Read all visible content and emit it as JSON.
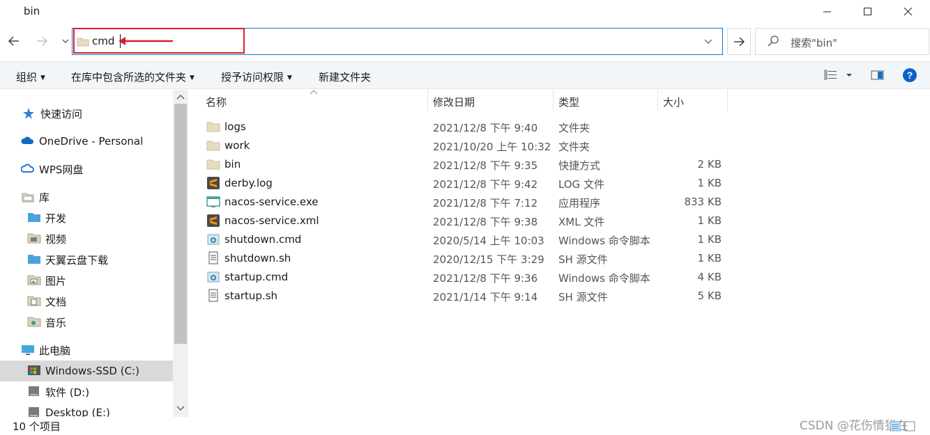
{
  "window": {
    "title": "bin",
    "minimize_icon": "minimize-icon",
    "maximize_icon": "maximize-icon",
    "close_icon": "close-icon"
  },
  "address_bar": {
    "nav_back": "←",
    "nav_forward": "→",
    "nav_recent": "⌄",
    "value": "cmd",
    "dropdown": "⌄",
    "go": "→",
    "highlight_color": "#d9202a"
  },
  "search": {
    "placeholder": "搜索\"bin\""
  },
  "toolbar": {
    "organize": "组织",
    "include_in_library": "在库中包含所选的文件夹",
    "grant_access": "授予访问权限",
    "new_folder": "新建文件夹",
    "dropdown_glyph": "▼"
  },
  "nav_pane": {
    "items": [
      {
        "label": "快速访问",
        "icon": "star-icon"
      },
      {
        "label": "OneDrive - Personal",
        "icon": "cloud-icon"
      },
      {
        "label": "WPS网盘",
        "icon": "cloud-icon"
      },
      {
        "label": "库",
        "icon": "library-icon"
      },
      {
        "label": "开发",
        "icon": "folder-icon"
      },
      {
        "label": "视频",
        "icon": "video-library-icon"
      },
      {
        "label": "天翼云盘下载",
        "icon": "folder-icon"
      },
      {
        "label": "图片",
        "icon": "picture-library-icon"
      },
      {
        "label": "文档",
        "icon": "document-library-icon"
      },
      {
        "label": "音乐",
        "icon": "music-library-icon"
      },
      {
        "label": "此电脑",
        "icon": "computer-icon"
      },
      {
        "label": "Windows-SSD (C:)",
        "icon": "windows-drive-icon"
      },
      {
        "label": "软件 (D:)",
        "icon": "drive-icon"
      },
      {
        "label": "Desktop (E:)",
        "icon": "drive-icon"
      }
    ],
    "selected_index": 11
  },
  "file_list": {
    "columns": {
      "name": "名称",
      "date": "修改日期",
      "type": "类型",
      "size": "大小"
    },
    "sort_indicator": "^",
    "rows": [
      {
        "name": "logs",
        "date": "2021/12/8 下午 9:40",
        "type": "文件夹",
        "size": "",
        "icon": "folder-icon"
      },
      {
        "name": "work",
        "date": "2021/10/20 上午 10:32",
        "type": "文件夹",
        "size": "",
        "icon": "folder-icon"
      },
      {
        "name": "bin",
        "date": "2021/12/8 下午 9:35",
        "type": "快捷方式",
        "size": "2 KB",
        "icon": "folder-icon"
      },
      {
        "name": "derby.log",
        "date": "2021/12/8 下午 9:42",
        "type": "LOG 文件",
        "size": "1 KB",
        "icon": "sublime-icon"
      },
      {
        "name": "nacos-service.exe",
        "date": "2021/12/8 下午 7:12",
        "type": "应用程序",
        "size": "833 KB",
        "icon": "application-icon"
      },
      {
        "name": "nacos-service.xml",
        "date": "2021/12/8 下午 9:38",
        "type": "XML 文件",
        "size": "1 KB",
        "icon": "sublime-icon"
      },
      {
        "name": "shutdown.cmd",
        "date": "2020/5/14 上午 10:03",
        "type": "Windows 命令脚本",
        "size": "1 KB",
        "icon": "gear-script-icon"
      },
      {
        "name": "shutdown.sh",
        "date": "2020/12/15 下午 3:29",
        "type": "SH 源文件",
        "size": "1 KB",
        "icon": "text-file-icon"
      },
      {
        "name": "startup.cmd",
        "date": "2021/12/8 下午 9:36",
        "type": "Windows 命令脚本",
        "size": "4 KB",
        "icon": "gear-script-icon"
      },
      {
        "name": "startup.sh",
        "date": "2021/1/14 下午 9:14",
        "type": "SH 源文件",
        "size": "5 KB",
        "icon": "text-file-icon"
      }
    ]
  },
  "status_bar": {
    "item_count": "10 个项目"
  },
  "watermark": "CSDN @花伤情犹在"
}
